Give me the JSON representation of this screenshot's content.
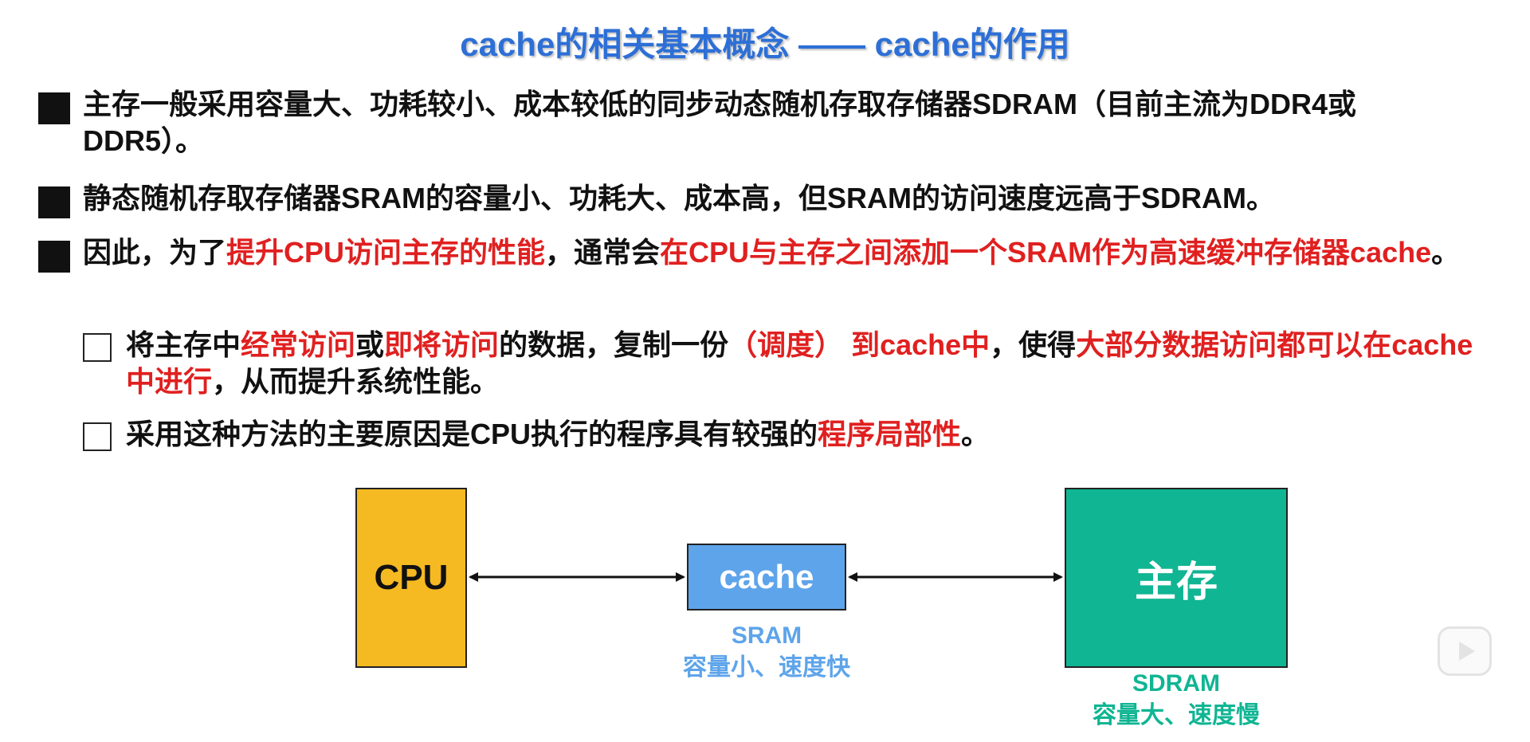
{
  "slide": {
    "title": "cache的相关基本概念 —— cache的作用",
    "bullets": [
      {
        "parts": [
          "主存一般采用容量大、功耗较小、成本较低的同步动态随机存取存储器SDRAM（目前主流为DDR4或DDR5）。"
        ]
      },
      {
        "parts": [
          "静态随机存取存储器SRAM的容量小、功耗大、成本高，但SRAM的访问速度远高于SDRAM。"
        ]
      },
      {
        "parts": [
          "因此，为了",
          "提升CPU访问主存的性能",
          "，通常会",
          "在CPU与主存之间添加一个SRAM作为高速缓冲存储器cache",
          "。"
        ]
      }
    ],
    "subbullets": [
      {
        "parts": [
          "将主存中",
          "经常访问",
          "或",
          "即将访问",
          "的数据，复制一份",
          "（调度） 到cache中",
          "，使得",
          "大部分数据访问都可以在cache中进行",
          "，从而提升系统性能。"
        ]
      },
      {
        "parts": [
          "采用这种方法的主要原因是CPU执行的程序具有较强的",
          "程序局部性",
          "。"
        ]
      }
    ]
  },
  "diagram": {
    "cpu_label": "CPU",
    "cache_label": "cache",
    "memory_label": "主存",
    "sram_caption": "SRAM",
    "sram_desc": "容量小、速度快",
    "sdram_caption": "SDRAM",
    "sdram_desc": "容量大、速度慢"
  },
  "colors": {
    "title": "#2d6fd6",
    "highlight": "#e02020",
    "cpu_fill": "#f5b921",
    "cache_fill": "#5ea4ea",
    "memory_fill": "#10b593"
  },
  "icons": {
    "player_button": "video-play-icon"
  }
}
